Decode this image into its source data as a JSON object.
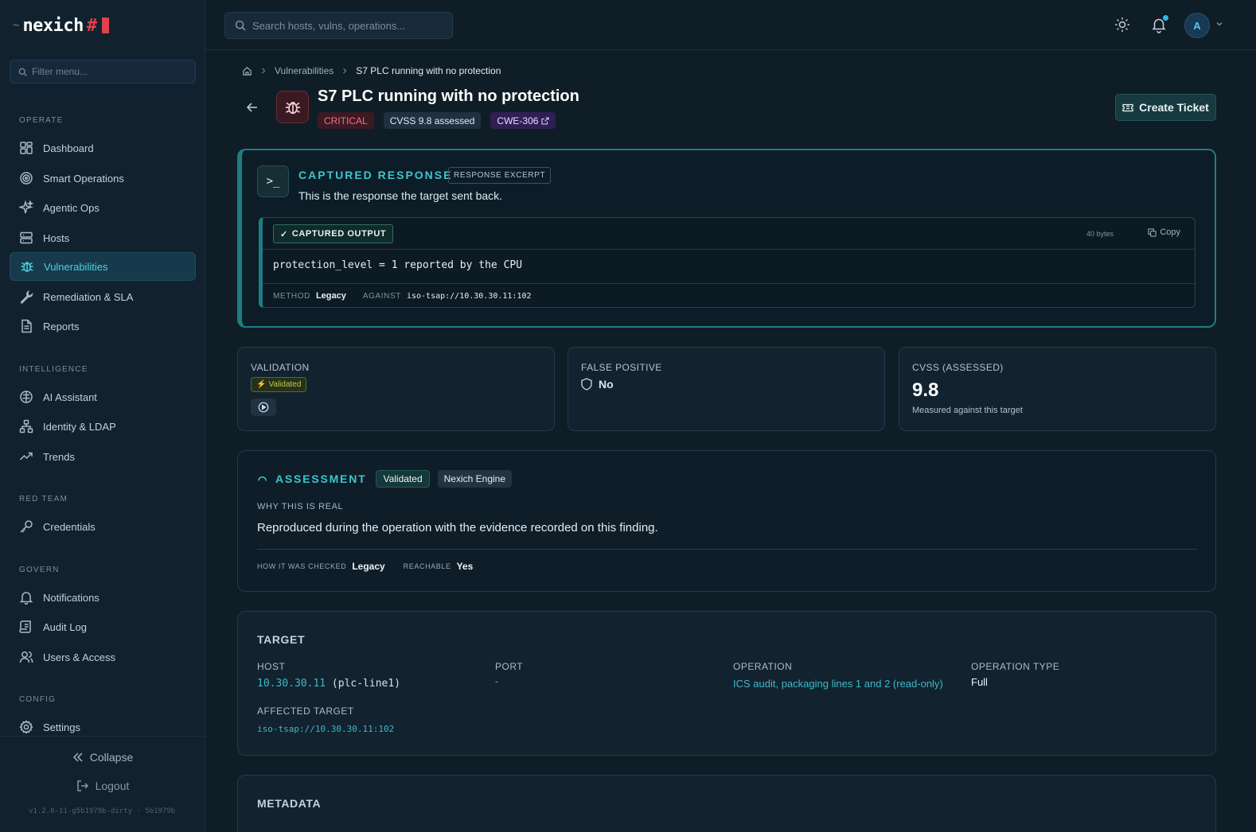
{
  "brand": {
    "tilde": "~",
    "name": "nexich",
    "hash": "#"
  },
  "sidebar": {
    "filter_placeholder": "Filter menu...",
    "sections": {
      "operate": "OPERATE",
      "intelligence": "INTELLIGENCE",
      "red_team": "RED TEAM",
      "govern": "GOVERN",
      "config": "CONFIG"
    },
    "items": {
      "dashboard": "Dashboard",
      "smart_operations": "Smart Operations",
      "agentic_ops": "Agentic Ops",
      "hosts": "Hosts",
      "vulnerabilities": "Vulnerabilities",
      "remediation": "Remediation & SLA",
      "reports": "Reports",
      "ai_assistant": "AI Assistant",
      "identity": "Identity & LDAP",
      "trends": "Trends",
      "credentials": "Credentials",
      "notifications": "Notifications",
      "audit_log": "Audit Log",
      "users": "Users & Access",
      "settings": "Settings"
    },
    "active": "vulnerabilities",
    "collapse": "Collapse",
    "logout": "Logout",
    "version": "v1.2.0-11-g5b1979b-dirty · 5b1979b"
  },
  "header": {
    "search_placeholder": "Search hosts, vulns, operations...",
    "avatar_initial": "A",
    "notification_dot": true
  },
  "breadcrumb": {
    "parent": "Vulnerabilities",
    "current": "S7 PLC running with no protection"
  },
  "finding": {
    "title": "S7 PLC running with no protection",
    "severity": "CRITICAL",
    "cvss_badge": "CVSS 9.8 assessed",
    "cwe": "CWE-306",
    "create_ticket": "Create Ticket"
  },
  "captured_response": {
    "title": "CAPTURED RESPONSE",
    "tag": "RESPONSE EXCERPT",
    "description": "This is the response the target sent back.",
    "output_label": "CAPTURED OUTPUT",
    "bytes": "40 bytes",
    "copy": "Copy",
    "output": "protection_level = 1 reported by the CPU",
    "method_key": "METHOD",
    "method_val": "Legacy",
    "against_key": "AGAINST",
    "against_val": "iso-tsap://10.30.30.11:102"
  },
  "stats": {
    "validation_label": "VALIDATION",
    "validation_pill": "Validated",
    "false_positive_label": "FALSE POSITIVE",
    "false_positive_value": "No",
    "cvss_label": "CVSS (ASSESSED)",
    "cvss_value": "9.8",
    "cvss_sub": "Measured against this target"
  },
  "assessment": {
    "title": "ASSESSMENT",
    "pill_validated": "Validated",
    "pill_engine": "Nexich Engine",
    "why_label": "WHY THIS IS REAL",
    "why_text": "Reproduced during the operation with the evidence recorded on this finding.",
    "how_key": "HOW IT WAS CHECKED",
    "how_val": "Legacy",
    "reach_key": "REACHABLE",
    "reach_val": "Yes"
  },
  "target": {
    "title": "TARGET",
    "host_label": "HOST",
    "host_ip": "10.30.30.11",
    "host_name": "(plc-line1)",
    "port_label": "PORT",
    "port_val": "-",
    "operation_label": "OPERATION",
    "operation_val": "ICS audit, packaging lines 1 and 2 (read-only)",
    "op_type_label": "OPERATION TYPE",
    "op_type_val": "Full",
    "affected_label": "AFFECTED TARGET",
    "affected_val": "iso-tsap://10.30.30.11:102"
  },
  "metadata": {
    "title": "METADATA"
  },
  "colors": {
    "accent": "#3ec5cc",
    "critical": "#ff6a7e",
    "active_nav": "#4fd0e0"
  }
}
